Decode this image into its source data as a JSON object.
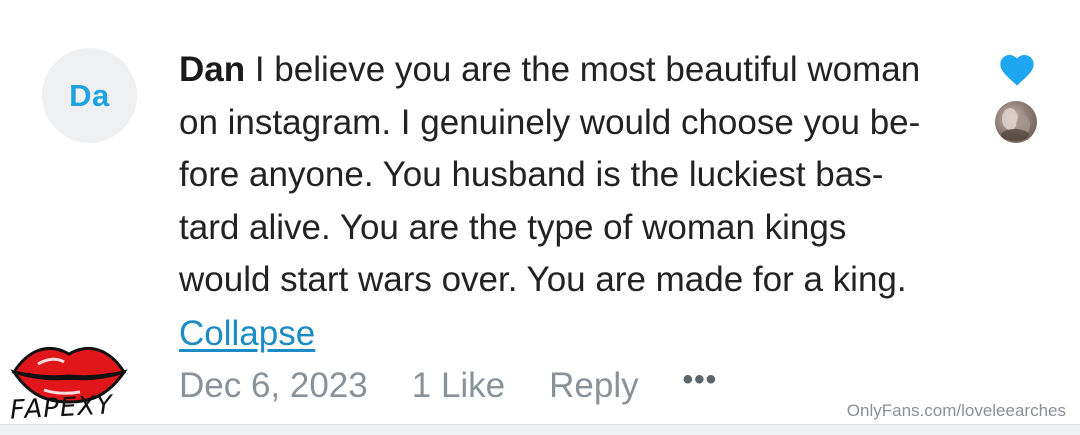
{
  "comment": {
    "avatar_initials": "Da",
    "author": "Dan",
    "text_lines": [
      "I believe you are the most beautiful woman",
      "on instagram. I genuinely would choose you be-",
      "fore anyone. You husband is the luckiest bas-",
      "tard alive. You are the type of woman kings",
      "would start wars over. You are made for a king."
    ],
    "collapse_label": "Collapse",
    "date": "Dec 6, 2023",
    "likes_label": "1 Like",
    "reply_label": "Reply",
    "more_label": "•••"
  },
  "watermark": "OnlyFans.com/loveleearches",
  "logo_text": "FAPEXY",
  "colors": {
    "accent": "#1b8cc5",
    "heart": "#1ea7f0",
    "avatar_text": "#1ea3e0",
    "avatar_bg": "#eef0f2",
    "meta": "#8a9299",
    "lips": "#e0161b"
  }
}
